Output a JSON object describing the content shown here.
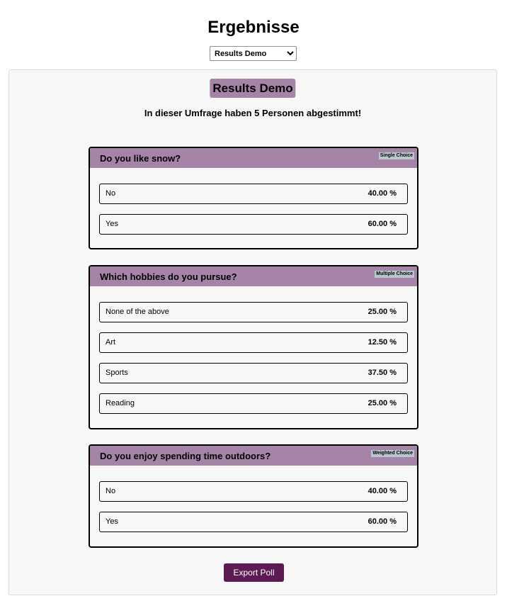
{
  "header": {
    "title": "Ergebnisse"
  },
  "poll_select": {
    "selected": "Results Demo",
    "options": [
      "Results Demo"
    ]
  },
  "poll": {
    "title": "Results Demo",
    "summary": "In dieser Umfrage haben 5 Personen abgestimmt!",
    "questions": [
      {
        "text": "Do you like snow?",
        "type": "Single Choice",
        "answers": [
          {
            "label": "No",
            "percent": "40.00 %"
          },
          {
            "label": "Yes",
            "percent": "60.00 %"
          }
        ]
      },
      {
        "text": "Which hobbies do you pursue?",
        "type": "Multiple Choice",
        "answers": [
          {
            "label": "None of the above",
            "percent": "25.00 %"
          },
          {
            "label": "Art",
            "percent": "12.50 %"
          },
          {
            "label": "Sports",
            "percent": "37.50 %"
          },
          {
            "label": "Reading",
            "percent": "25.00 %"
          }
        ]
      },
      {
        "text": "Do you enjoy spending time outdoors?",
        "type": "Weighted Choice",
        "answers": [
          {
            "label": "No",
            "percent": "40.00 %"
          },
          {
            "label": "Yes",
            "percent": "60.00 %"
          }
        ]
      }
    ]
  },
  "export_button": {
    "label": "Export Poll"
  },
  "colors": {
    "accent": "#a584a8",
    "button": "#5c1a52",
    "type_badge": "#b7c7cc",
    "panel_bg": "#f7f7f7"
  }
}
